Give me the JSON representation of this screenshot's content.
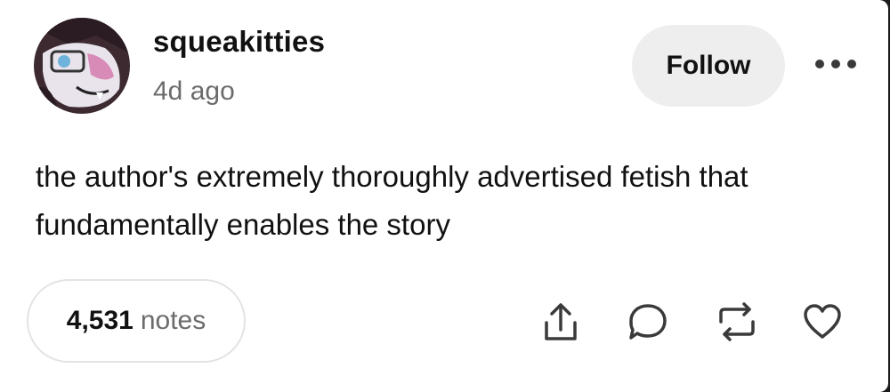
{
  "post": {
    "username": "squeakitties",
    "timestamp": "4d ago",
    "body": "the author's extremely thoroughly advertised fetish that fundamentally enables the story"
  },
  "header": {
    "follow_label": "Follow"
  },
  "footer": {
    "notes_count": "4,531",
    "notes_label": "notes"
  },
  "icons": {
    "more": "more-horizontal-icon",
    "share": "share-icon",
    "reply": "reply-icon",
    "reblog": "reblog-icon",
    "like": "heart-icon"
  },
  "colors": {
    "text": "#111111",
    "muted": "#6b6b6b",
    "follow_bg": "#eeeeee",
    "pill_border": "#e3e3e3"
  }
}
